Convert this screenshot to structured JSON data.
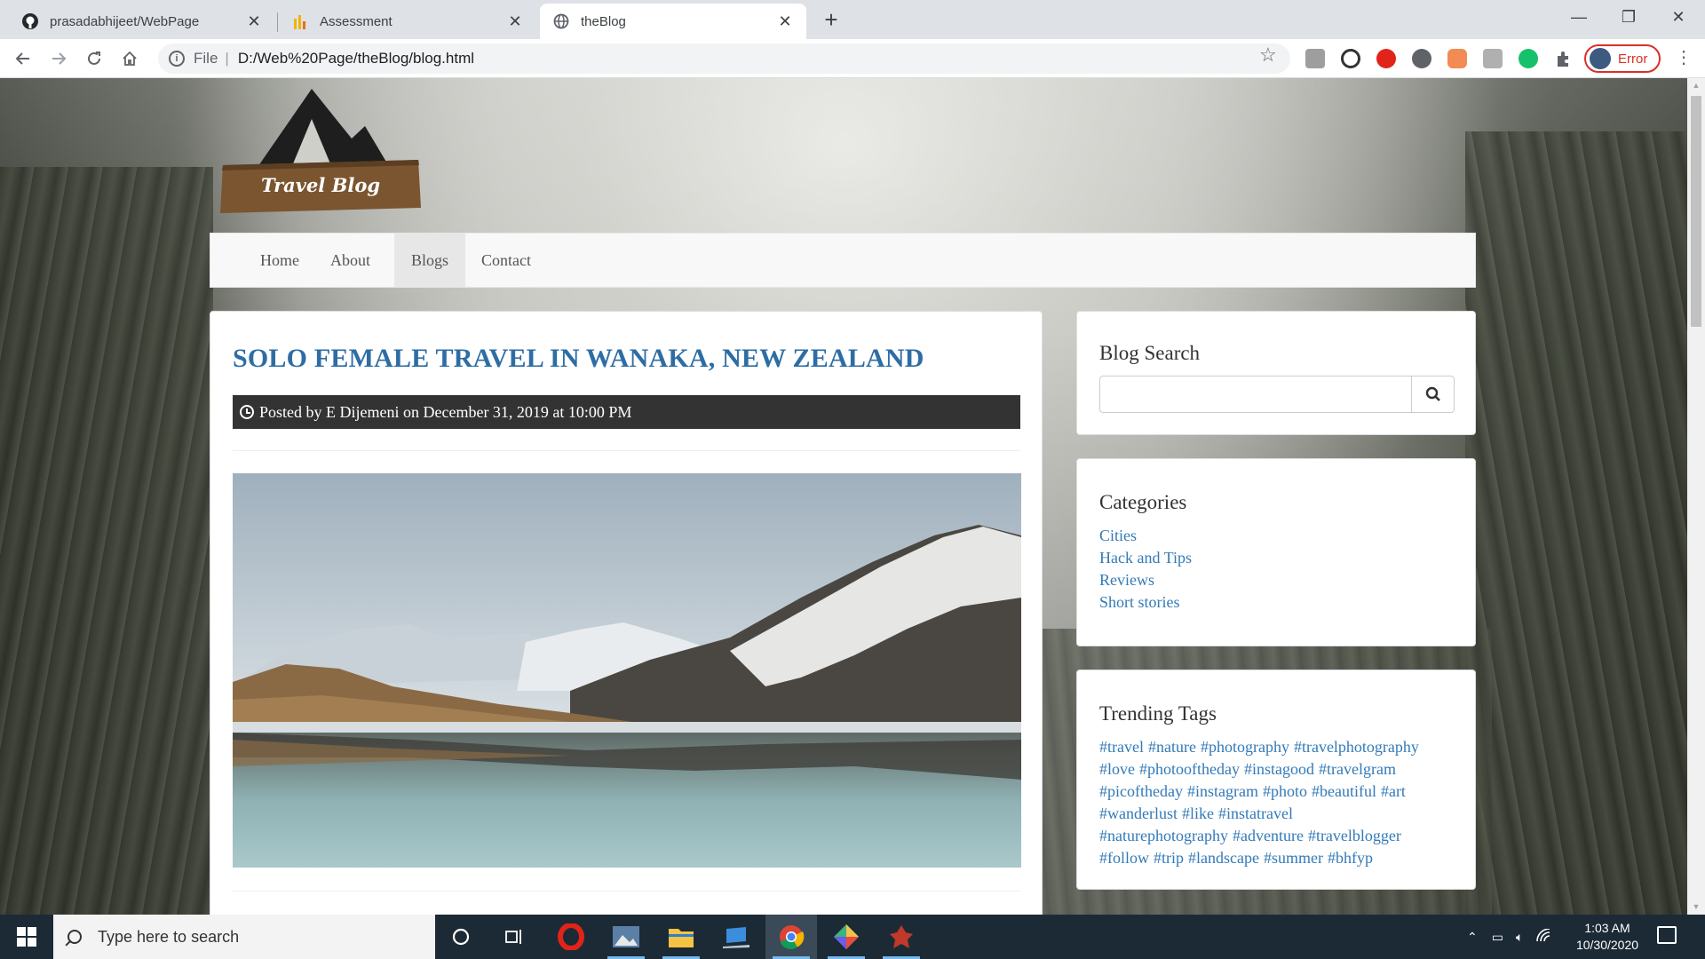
{
  "browser": {
    "tabs": [
      {
        "title": "prasadabhijeet/WebPage",
        "icon": "github-icon"
      },
      {
        "title": "Assessment",
        "icon": "chart-icon"
      },
      {
        "title": "theBlog",
        "icon": "globe-icon"
      }
    ],
    "address": {
      "scheme": "File",
      "url": "D:/Web%20Page/theBlog/blog.html"
    },
    "profile_label": "Error"
  },
  "logo": {
    "text": "Travel Blog"
  },
  "nav": {
    "items": [
      "Home",
      "About",
      "Blogs",
      "Contact"
    ],
    "active": "Blogs"
  },
  "post": {
    "title": "SOLO FEMALE TRAVEL IN WANAKA, NEW ZEALAND",
    "meta": "Posted by E Dijemeni on December 31, 2019 at 10:00 PM"
  },
  "sidebar": {
    "search": {
      "heading": "Blog Search",
      "value": ""
    },
    "categories": {
      "heading": "Categories",
      "items": [
        "Cities",
        "Hack and Tips",
        "Reviews",
        "Short stories"
      ]
    },
    "tags": {
      "heading": "Trending Tags",
      "items": [
        "#travel",
        "#nature",
        "#photography",
        "#travelphotography",
        "#love",
        "#photooftheday",
        "#instagood",
        "#travelgram",
        "#picoftheday",
        "#instagram",
        "#photo",
        "#beautiful",
        "#art",
        "#wanderlust",
        "#like",
        "#instatravel",
        "#naturephotography",
        "#adventure",
        "#travelblogger",
        "#follow",
        "#trip",
        "#landscape",
        "#summer",
        "#bhfyp"
      ]
    }
  },
  "taskbar": {
    "search_placeholder": "Type here to search",
    "time": "1:03 AM",
    "date": "10/30/2020"
  },
  "colors": {
    "link": "#337ab7",
    "title": "#2e6da4",
    "meta_bg": "#333333",
    "accent_error": "#d93025"
  }
}
